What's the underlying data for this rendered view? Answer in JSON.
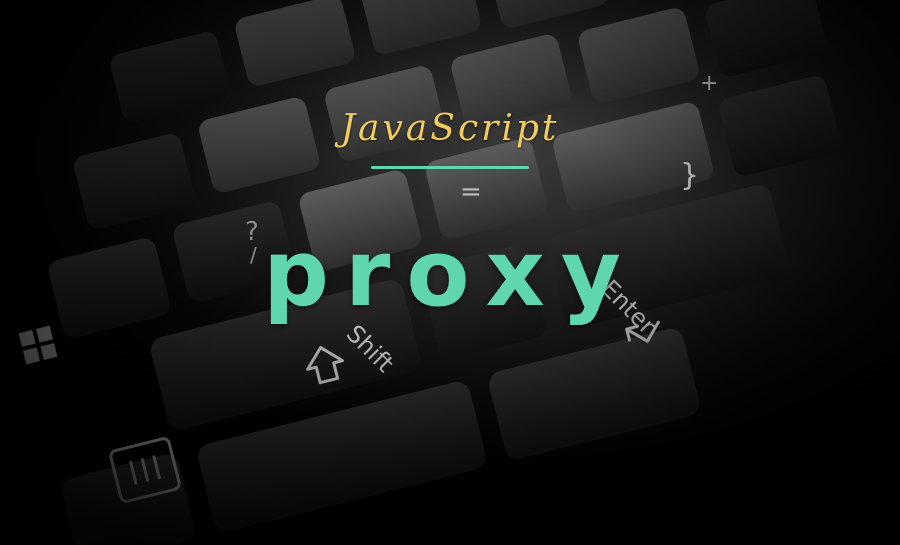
{
  "banner": {
    "subtitle": "JavaScript",
    "title": "proxy",
    "accent_color": "#5fd6b0",
    "subtitle_color": "#f2cb5d"
  },
  "keyboard": {
    "shift_key_label": "Shift",
    "enter_key_label": "Enter",
    "icons": [
      "shift-arrow-icon",
      "enter-arrow-icon",
      "windows-logo-icon",
      "menu-key-icon"
    ]
  }
}
